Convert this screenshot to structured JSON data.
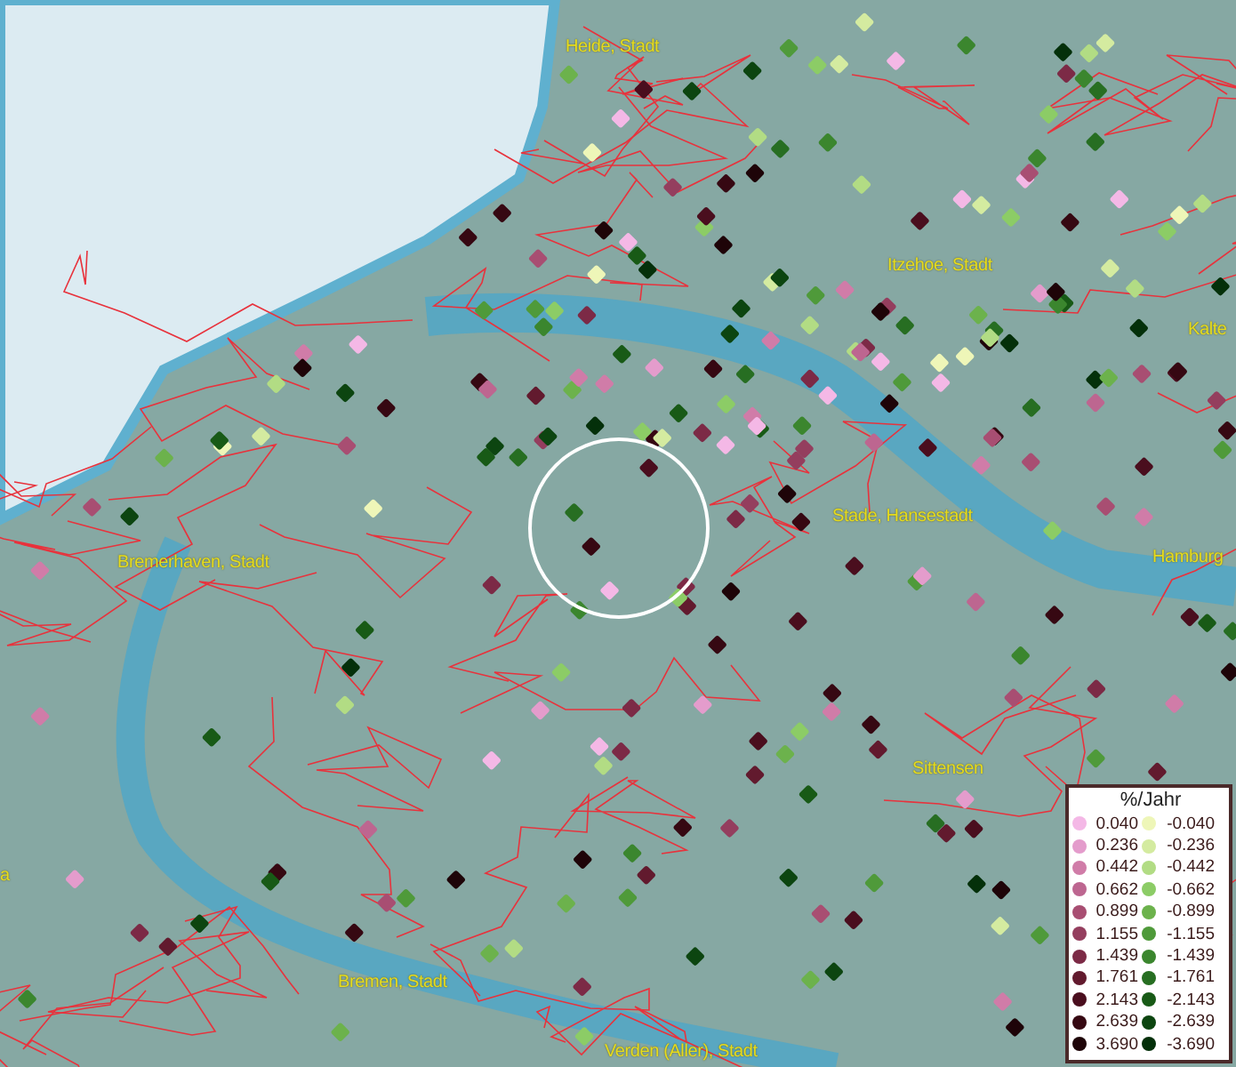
{
  "map": {
    "places": [
      {
        "name": "Heide, Stadt"
      },
      {
        "name": "Itzehoe, Stadt"
      },
      {
        "name": "Kalte"
      },
      {
        "name": "Stade, Hansestadt"
      },
      {
        "name": "Hamburg"
      },
      {
        "name": "Bremerhaven, Stadt"
      },
      {
        "name": "Sittensen"
      },
      {
        "name": "a"
      },
      {
        "name": "Bremen, Stadt"
      },
      {
        "name": "Verden (Aller), Stadt"
      }
    ]
  },
  "legend": {
    "title": "%/Jahr",
    "positive": [
      {
        "value": "0.040",
        "color": "#f4b8e6"
      },
      {
        "value": "0.236",
        "color": "#e49ccc"
      },
      {
        "value": "0.442",
        "color": "#d07ca8"
      },
      {
        "value": "0.662",
        "color": "#bd6690"
      },
      {
        "value": "0.899",
        "color": "#a84e72"
      },
      {
        "value": "1.155",
        "color": "#943e5e"
      },
      {
        "value": "1.439",
        "color": "#7c2a46"
      },
      {
        "value": "1.761",
        "color": "#621a2e"
      },
      {
        "value": "2.143",
        "color": "#4a0e1e"
      },
      {
        "value": "2.639",
        "color": "#360812"
      },
      {
        "value": "3.690",
        "color": "#1e0408"
      }
    ],
    "negative": [
      {
        "value": "-0.040",
        "color": "#eef6b8"
      },
      {
        "value": "-0.236",
        "color": "#d4eba0"
      },
      {
        "value": "-0.442",
        "color": "#b2dc84"
      },
      {
        "value": "-0.662",
        "color": "#8ccc66"
      },
      {
        "value": "-0.899",
        "color": "#6cb24c"
      },
      {
        "value": "-1.155",
        "color": "#4f9a3a"
      },
      {
        "value": "-1.439",
        "color": "#3b862e"
      },
      {
        "value": "-1.761",
        "color": "#276e22"
      },
      {
        "value": "-2.143",
        "color": "#185a16"
      },
      {
        "value": "-2.639",
        "color": "#0c4510"
      },
      {
        "value": "-3.690",
        "color": "#04300a"
      }
    ]
  }
}
